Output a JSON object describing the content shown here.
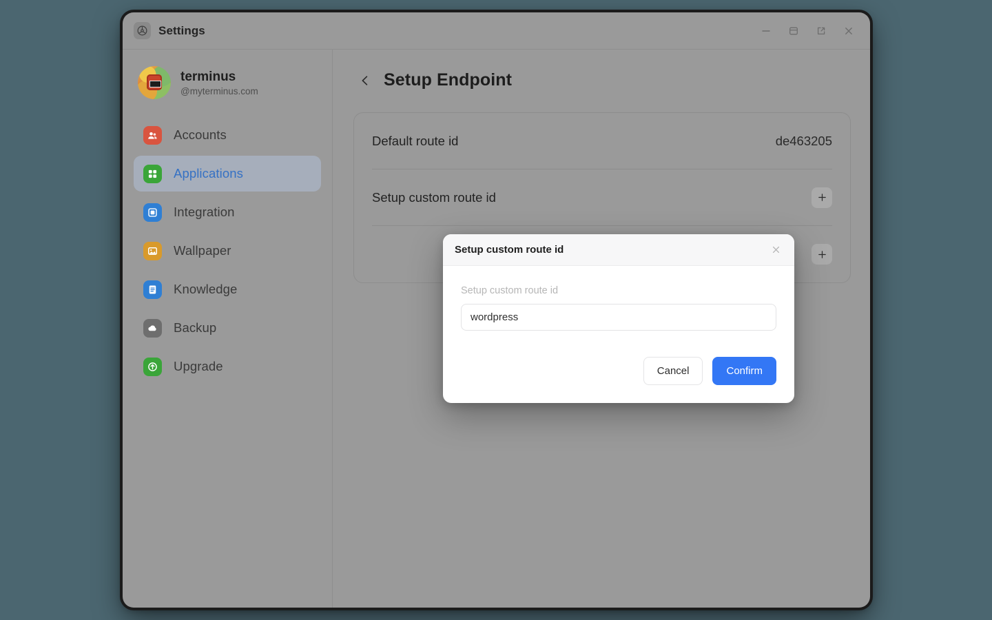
{
  "window": {
    "app_icon": "settings-gear-icon",
    "title": "Settings",
    "controls": [
      {
        "name": "minimize",
        "icon": "minimize-icon"
      },
      {
        "name": "restore",
        "icon": "window-panel-icon"
      },
      {
        "name": "popout",
        "icon": "external-link-icon"
      },
      {
        "name": "close",
        "icon": "close-icon"
      }
    ]
  },
  "sidebar": {
    "profile": {
      "name": "terminus",
      "handle": "@myterminus.com",
      "avatar": "user-avatar"
    },
    "items": [
      {
        "label": "Accounts",
        "icon": "accounts-icon",
        "color": "#d9543f",
        "active": false
      },
      {
        "label": "Applications",
        "icon": "applications-icon",
        "color": "#3aa539",
        "active": true
      },
      {
        "label": "Integration",
        "icon": "integration-icon",
        "color": "#2f7fd4",
        "active": false
      },
      {
        "label": "Wallpaper",
        "icon": "wallpaper-icon",
        "color": "#d99a2b",
        "active": false
      },
      {
        "label": "Knowledge",
        "icon": "knowledge-icon",
        "color": "#2f7fd4",
        "active": false
      },
      {
        "label": "Backup",
        "icon": "backup-cloud-icon",
        "color": "#6e6e6e",
        "active": false
      },
      {
        "label": "Upgrade",
        "icon": "upgrade-icon",
        "color": "#3aa539",
        "active": false
      }
    ]
  },
  "main": {
    "back_icon": "chevron-left-icon",
    "title": "Setup Endpoint",
    "rows": [
      {
        "label": "Default route id",
        "value": "de463205",
        "action": null
      },
      {
        "label": "Setup custom route id",
        "value": null,
        "action": "plus-icon"
      },
      {
        "label": "",
        "value": null,
        "action": "plus-icon"
      }
    ]
  },
  "modal": {
    "title": "Setup custom route id",
    "close_icon": "close-icon",
    "field": {
      "label": "Setup custom route id",
      "value": "wordpress",
      "placeholder": "Setup custom route id"
    },
    "cancel_label": "Cancel",
    "confirm_label": "Confirm"
  },
  "colors": {
    "desktop_background": "#4b6670",
    "window_background": "#9a9a9a",
    "accent_blue": "#3377f5",
    "active_nav_text": "#3571c4",
    "active_nav_background": "#a6aebb"
  }
}
